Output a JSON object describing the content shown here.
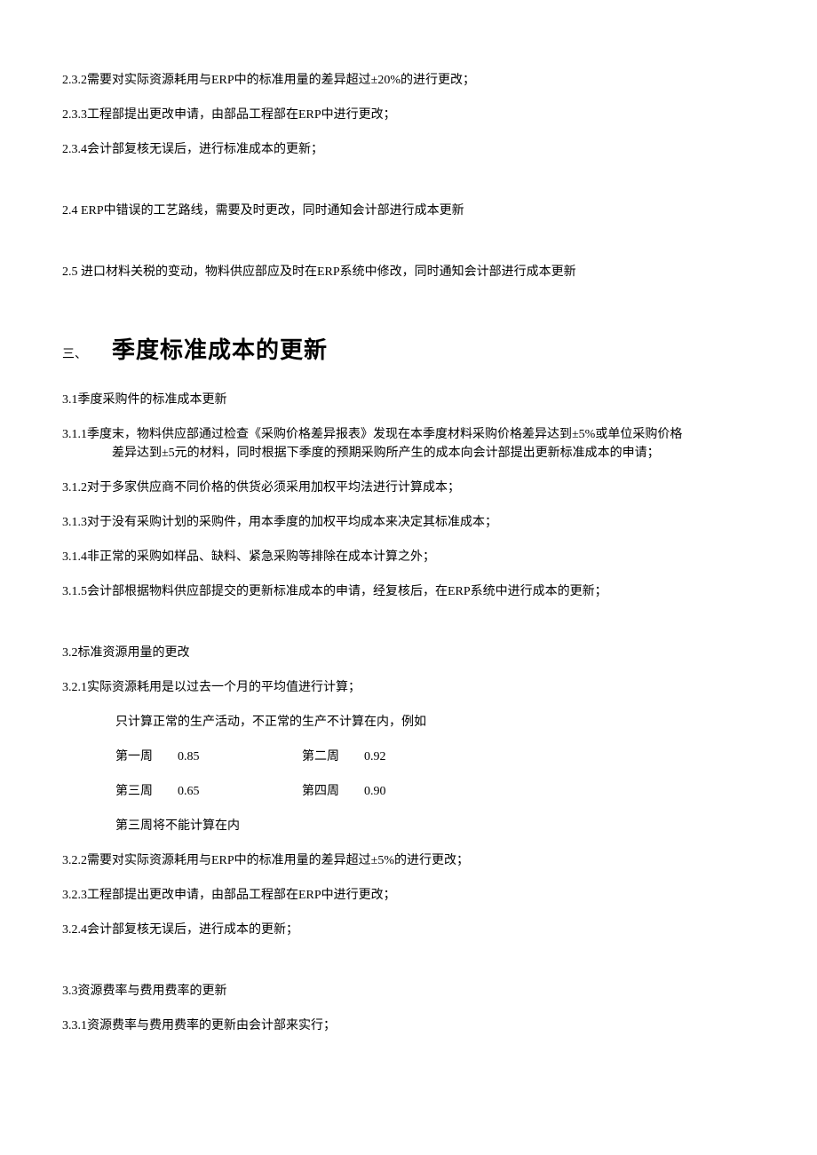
{
  "s232": "2.3.2需要对实际资源耗用与ERP中的标准用量的差异超过±20%的进行更改；",
  "s233": "2.3.3工程部提出更改申请，由部品工程部在ERP中进行更改；",
  "s234": "2.3.4会计部复核无误后，进行标准成本的更新；",
  "s24": "2.4 ERP中错误的工艺路线，需要及时更改，同时通知会计部进行成本更新",
  "s25": "2.5 进口材料关税的变动，物料供应部应及时在ERP系统中修改，同时通知会计部进行成本更新",
  "h3_num": "三、",
  "h3_title": "季度标准成本的更新",
  "s31": "3.1季度采购件的标准成本更新",
  "s311a": "3.1.1季度末，物料供应部通过检查《采购价格差异报表》发现在本季度材料采购价格差异达到±5%或单位采购价格",
  "s311b": "差异达到±5元的材料，同时根据下季度的预期采购所产生的成本向会计部提出更新标准成本的申请；",
  "s312": "3.1.2对于多家供应商不同价格的供货必须采用加权平均法进行计算成本；",
  "s313": "3.1.3对于没有采购计划的采购件，用本季度的加权平均成本来决定其标准成本；",
  "s314": "3.1.4非正常的采购如样品、缺料、紧急采购等排除在成本计算之外；",
  "s315": "3.1.5会计部根据物料供应部提交的更新标准成本的申请，经复核后，在ERP系统中进行成本的更新；",
  "s32": "3.2标准资源用量的更改",
  "s321": "3.2.1实际资源耗用是以过去一个月的平均值进行计算；",
  "s321n": "只计算正常的生产活动，不正常的生产不计算在内，例如",
  "wk1l": "第一周",
  "wk1v": "0.85",
  "wk2l": "第二周",
  "wk2v": "0.92",
  "wk3l": "第三周",
  "wk3v": "0.65",
  "wk4l": "第四周",
  "wk4v": "0.90",
  "s321e": "第三周将不能计算在内",
  "s322": "3.2.2需要对实际资源耗用与ERP中的标准用量的差异超过±5%的进行更改；",
  "s323": "3.2.3工程部提出更改申请，由部品工程部在ERP中进行更改；",
  "s324": "3.2.4会计部复核无误后，进行成本的更新；",
  "s33": "3.3资源费率与费用费率的更新",
  "s331": "3.3.1资源费率与费用费率的更新由会计部来实行；"
}
